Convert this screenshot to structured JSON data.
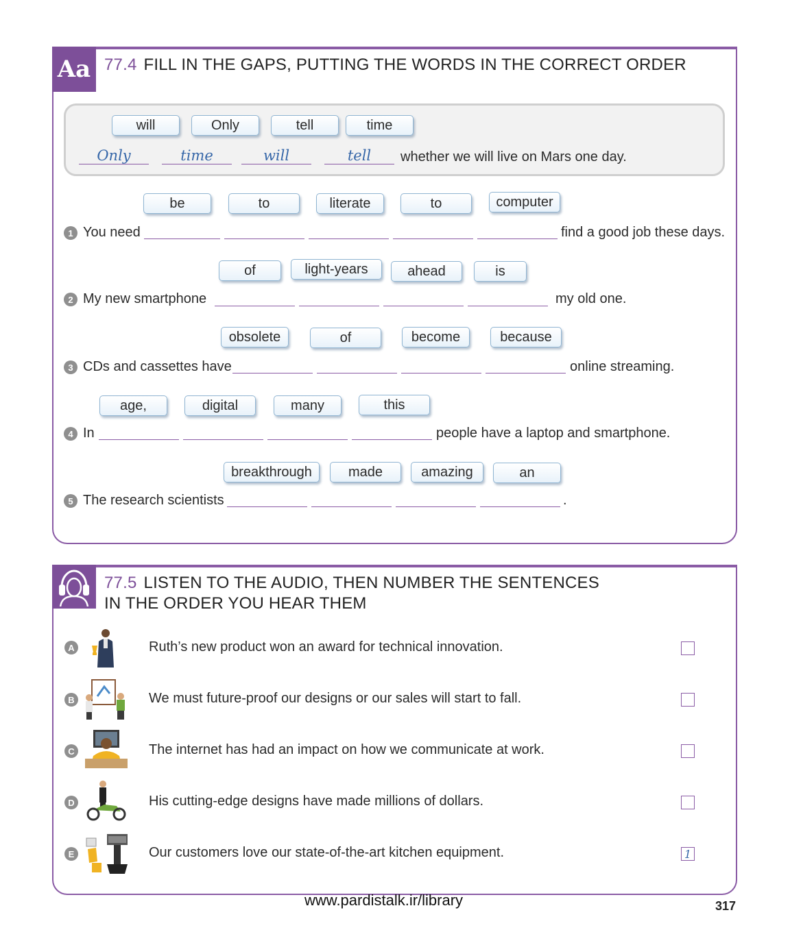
{
  "ex1": {
    "tag": "Aa",
    "number": "77.4",
    "title": "FILL IN THE GAPS, PUTTING THE WORDS IN THE CORRECT ORDER",
    "example": {
      "chips": [
        "will",
        "Only",
        "tell",
        "time"
      ],
      "answers": [
        "Only",
        "time",
        "will",
        "tell"
      ],
      "ending": "whether we will live on Mars one day."
    },
    "items": [
      {
        "n": "1",
        "chips": [
          "be",
          "to",
          "literate",
          "to",
          "computer"
        ],
        "start": "You need",
        "end": "find a good job these days."
      },
      {
        "n": "2",
        "chips": [
          "of",
          "light-years",
          "ahead",
          "is"
        ],
        "start": "My new smartphone",
        "end": "my old one."
      },
      {
        "n": "3",
        "chips": [
          "obsolete",
          "of",
          "become",
          "because"
        ],
        "start": "CDs and cassettes have",
        "end": "online streaming."
      },
      {
        "n": "4",
        "chips": [
          "age,",
          "digital",
          "many",
          "this"
        ],
        "start": "In",
        "end": "people have a laptop and smartphone."
      },
      {
        "n": "5",
        "chips": [
          "breakthrough",
          "made",
          "amazing",
          "an"
        ],
        "start": "The research scientists",
        "end": "."
      }
    ]
  },
  "ex2": {
    "icon": "headphones-icon",
    "number": "77.5",
    "title_line1": "LISTEN TO THE AUDIO, THEN NUMBER THE SENTENCES",
    "title_line2": "IN THE ORDER YOU HEAR THEM",
    "items": [
      {
        "letter": "A",
        "text": "Ruth’s new product won an award for technical innovation.",
        "answer": ""
      },
      {
        "letter": "B",
        "text": "We must future-proof our designs or our sales will start to fall.",
        "answer": ""
      },
      {
        "letter": "C",
        "text": "The internet has had an impact on how we communicate at work.",
        "answer": ""
      },
      {
        "letter": "D",
        "text": "His cutting-edge designs have made millions of dollars.",
        "answer": ""
      },
      {
        "letter": "E",
        "text": "Our customers love our state-of-the-art kitchen equipment.",
        "answer": "1"
      }
    ]
  },
  "footer": {
    "url": "www.pardistalk.ir/library",
    "page": "317"
  },
  "colors": {
    "accent": "#7d4f99",
    "chip_border": "#8fb4d2",
    "answer_ink": "#3566a8"
  }
}
